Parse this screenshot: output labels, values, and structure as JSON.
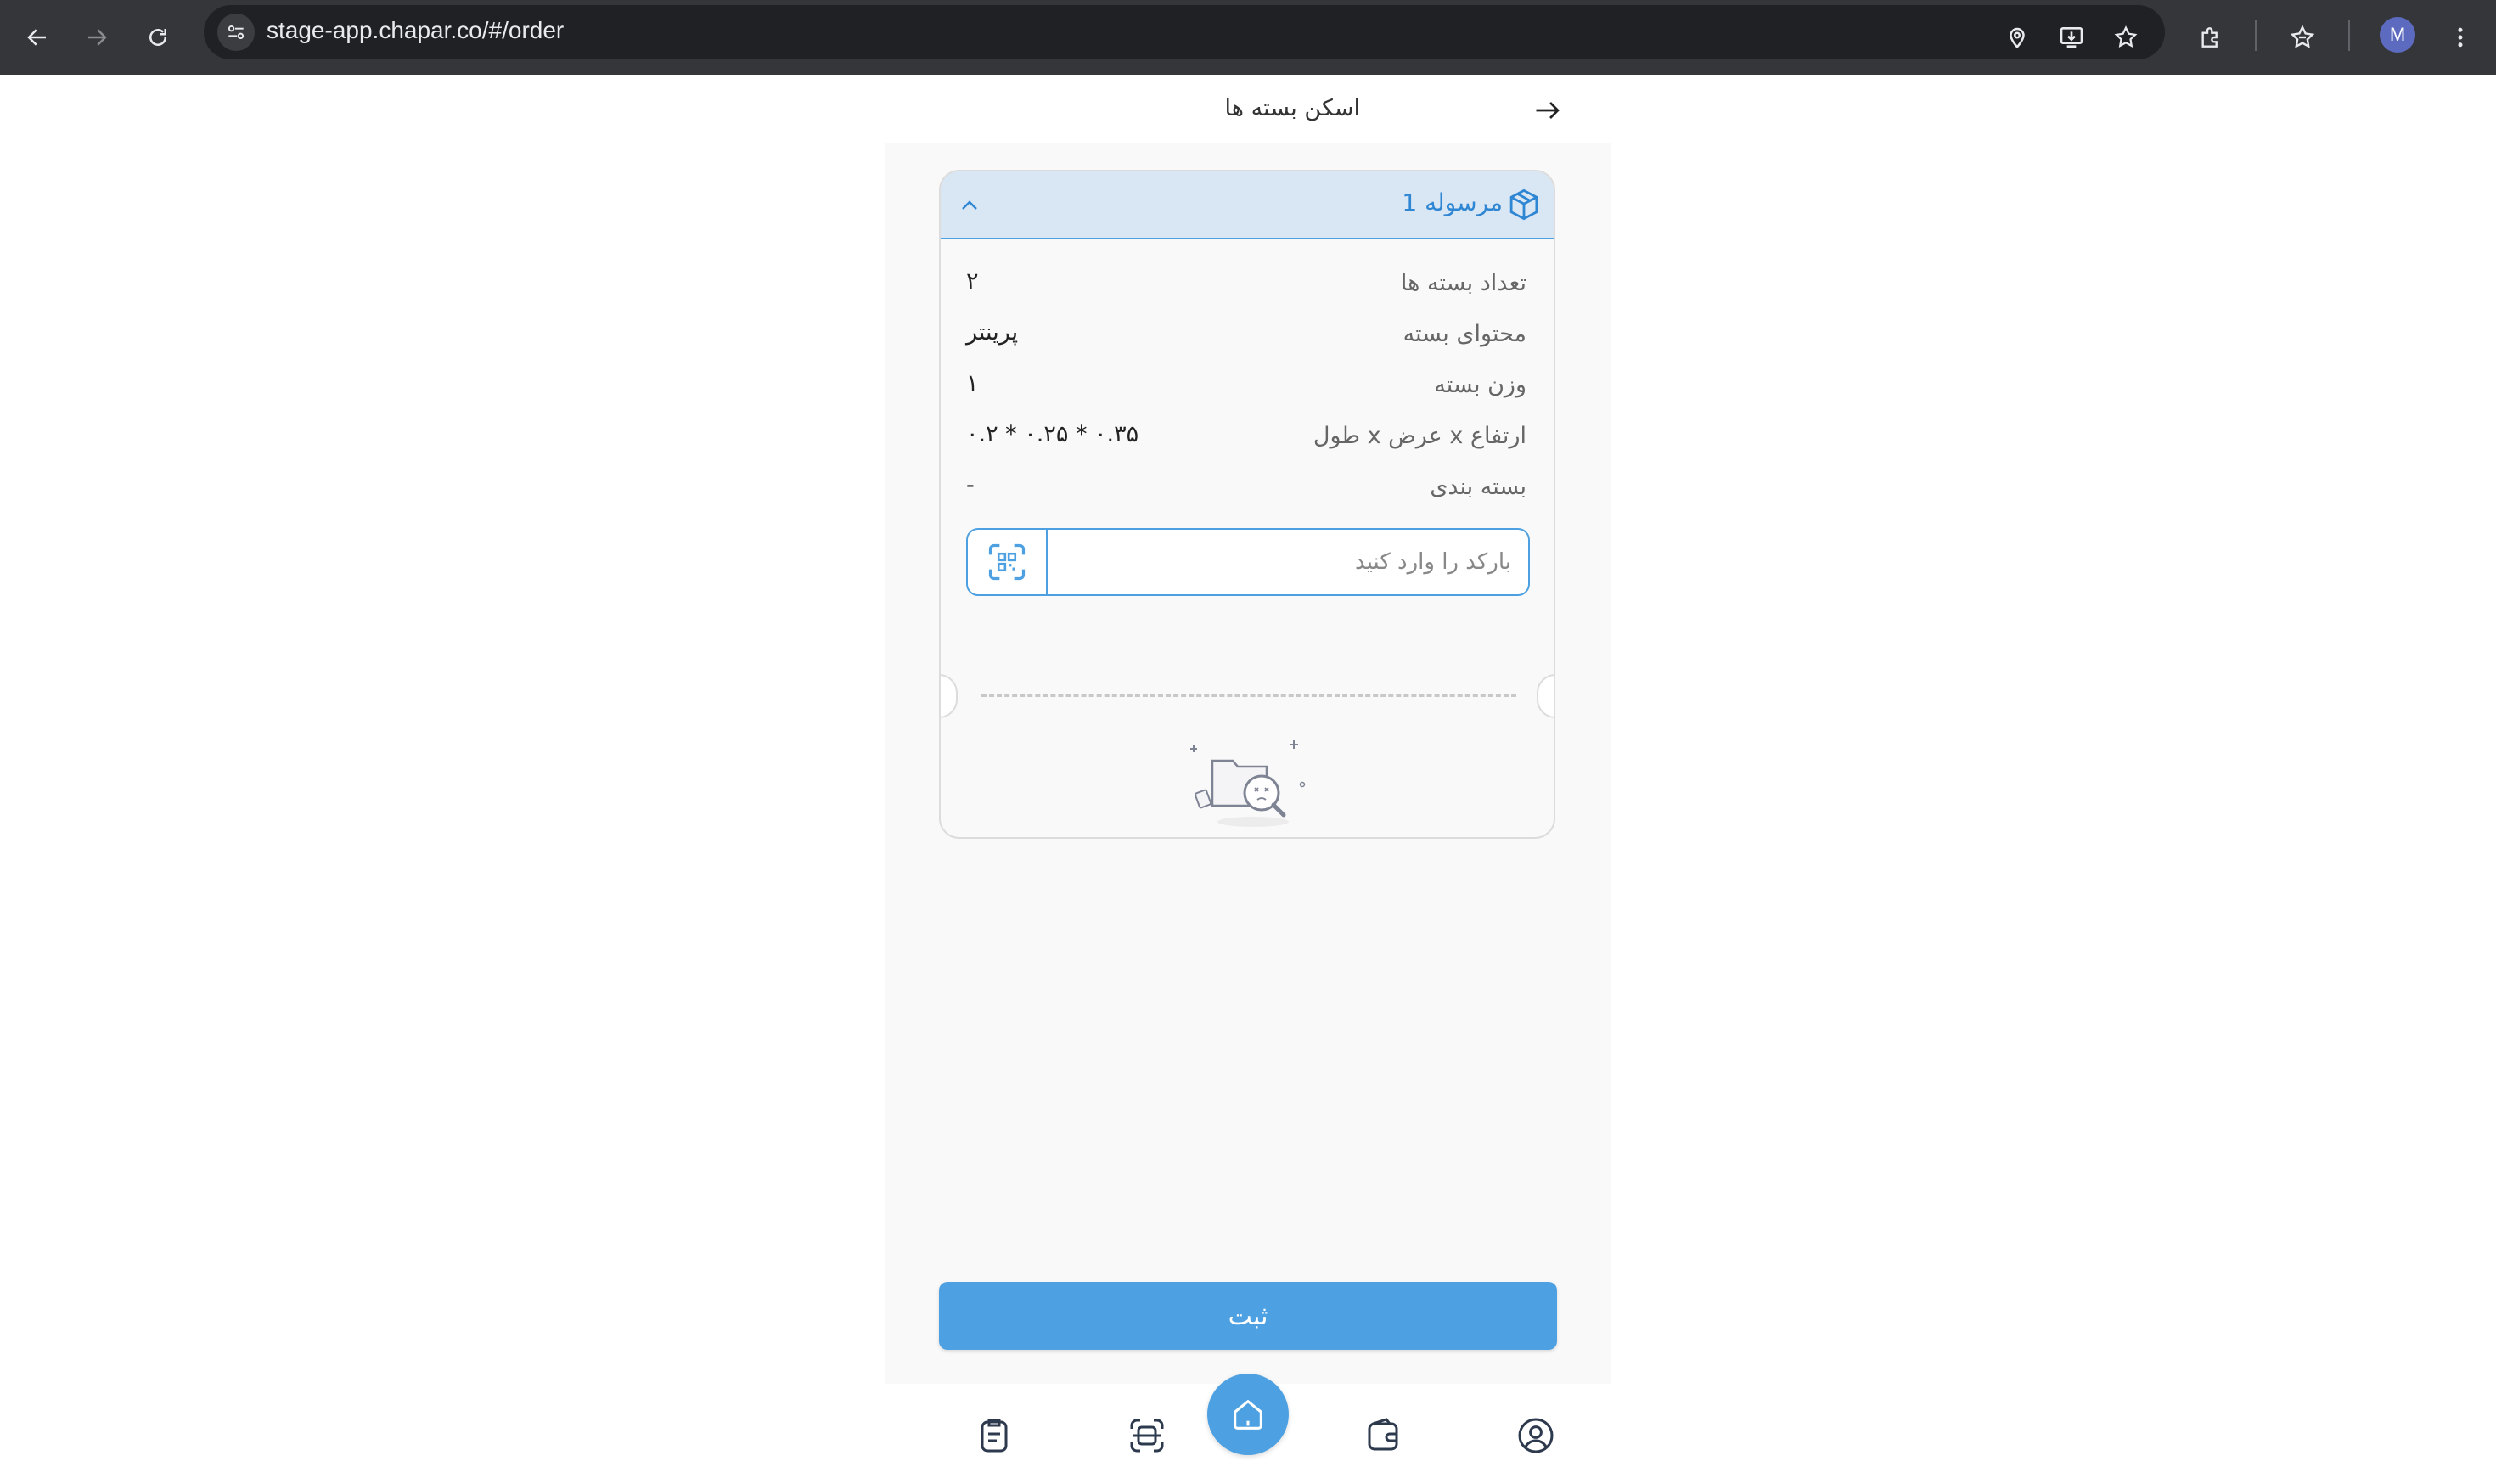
{
  "browser": {
    "url": "stage-app.chapar.co/#/order",
    "profile_initial": "M"
  },
  "header": {
    "title": "اسکن بسته ها"
  },
  "parcel": {
    "title": "مرسوله 1",
    "details": [
      {
        "label": "تعداد بسته ها",
        "value": "۲"
      },
      {
        "label": "محتوای بسته",
        "value": "پرینتر"
      },
      {
        "label": "وزن بسته",
        "value": "۱"
      },
      {
        "label": "ارتفاع x عرض x طول",
        "value": "۰.۳۵ * ۰.۲۵ * ۰.۲"
      },
      {
        "label": "بسته بندی",
        "value": "-"
      }
    ],
    "barcode_placeholder": "بارکد را وارد کنید"
  },
  "submit_label": "ثبت",
  "colors": {
    "accent": "#4da1e2",
    "header_bg": "#d9e6f4",
    "chrome_bg": "#35363a"
  },
  "bottom_nav": [
    "orders-icon",
    "scan-icon",
    "home-icon",
    "wallet-icon",
    "profile-icon"
  ]
}
